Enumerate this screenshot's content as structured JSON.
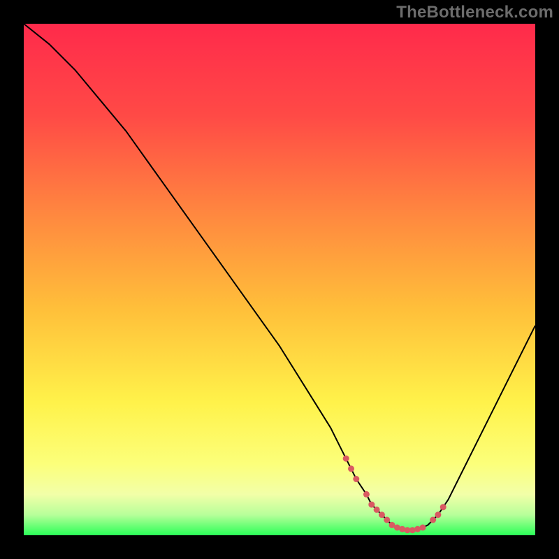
{
  "watermark": "TheBottleneck.com",
  "chart_data": {
    "type": "line",
    "title": "",
    "xlabel": "",
    "ylabel": "",
    "xlim": [
      0,
      100
    ],
    "ylim": [
      0,
      100
    ],
    "x": [
      0,
      5,
      10,
      15,
      20,
      25,
      30,
      35,
      40,
      45,
      50,
      55,
      60,
      62,
      64,
      65,
      67,
      68,
      69,
      70,
      71,
      72,
      73,
      74,
      75,
      76,
      77,
      78,
      79,
      80,
      81,
      83,
      85,
      90,
      95,
      100
    ],
    "values": [
      100,
      96,
      91,
      85,
      79,
      72,
      65,
      58,
      51,
      44,
      37,
      29,
      21,
      17,
      13,
      11,
      8,
      6,
      5,
      4,
      3,
      2,
      1.5,
      1.2,
      1.0,
      1.0,
      1.2,
      1.5,
      2,
      3,
      4,
      7,
      11,
      21,
      31,
      41
    ],
    "dot_x": [
      63,
      64,
      65,
      67,
      68,
      69,
      70,
      71,
      72,
      73,
      74,
      75,
      76,
      77,
      78,
      80,
      81,
      82
    ],
    "dot_y": [
      15.0,
      13.0,
      11.0,
      8.0,
      6.0,
      5.0,
      4.0,
      3.0,
      2.0,
      1.5,
      1.2,
      1.0,
      1.0,
      1.2,
      1.5,
      3.0,
      4.0,
      5.5
    ],
    "gradient_stops": [
      {
        "offset": 0.0,
        "color": "#ff2a4b"
      },
      {
        "offset": 0.18,
        "color": "#ff4a46"
      },
      {
        "offset": 0.38,
        "color": "#ff8a3f"
      },
      {
        "offset": 0.56,
        "color": "#ffc03a"
      },
      {
        "offset": 0.74,
        "color": "#fff24a"
      },
      {
        "offset": 0.86,
        "color": "#fcff7a"
      },
      {
        "offset": 0.92,
        "color": "#f2ffa8"
      },
      {
        "offset": 0.96,
        "color": "#b8ff9a"
      },
      {
        "offset": 1.0,
        "color": "#2bff58"
      }
    ],
    "line_color": "#000000",
    "dot_color": "#d95a62"
  }
}
